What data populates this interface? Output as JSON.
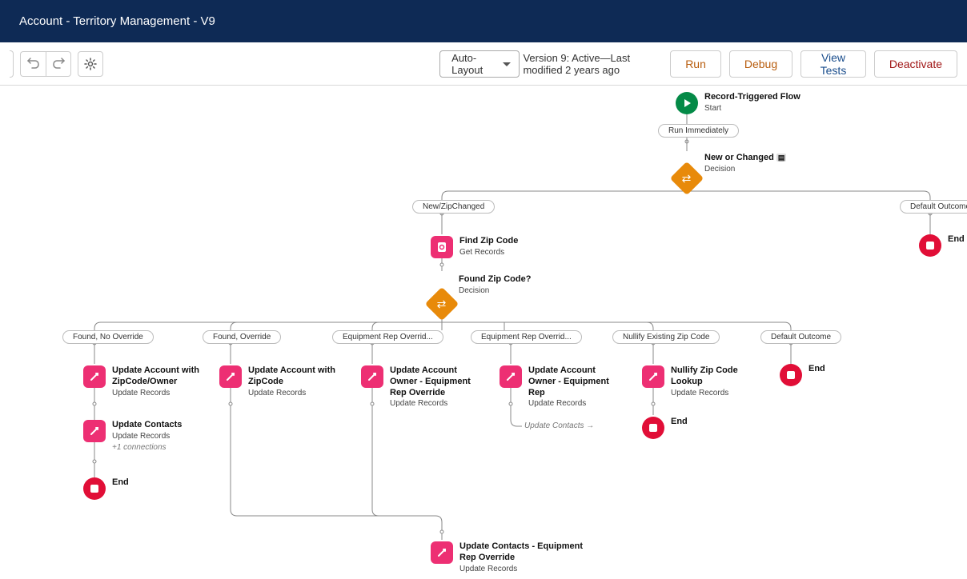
{
  "header": {
    "title": "Account - Territory Management - V9"
  },
  "toolbar": {
    "auto_layout": "Auto-Layout",
    "status": "Version 9: Active—Last modified 2 years ago",
    "run": "Run",
    "debug": "Debug",
    "view_tests": "View Tests",
    "deactivate": "Deactivate"
  },
  "flow": {
    "start": {
      "title": "Record-Triggered Flow",
      "sub": "Start"
    },
    "run_immediately": "Run Immediately",
    "decision1": {
      "title": "New or Changed",
      "sub": "Decision"
    },
    "outcome_new": "New/ZipChanged",
    "outcome_default1": "Default Outcome",
    "end_top": "End",
    "find_zip": {
      "title": "Find Zip Code",
      "sub": "Get Records"
    },
    "decision2": {
      "title": "Found Zip Code?",
      "sub": "Decision"
    },
    "out_found_no_override": "Found, No Override",
    "out_found_override": "Found, Override",
    "out_equip_override1": "Equipment Rep Overrid...",
    "out_equip_override2": "Equipment Rep Overrid...",
    "out_nullify": "Nullify Existing Zip Code",
    "out_default2": "Default Outcome",
    "n1": {
      "title": "Update Account with ZipCode/Owner",
      "sub": "Update Records"
    },
    "n2": {
      "title": "Update Account with ZipCode",
      "sub": "Update Records"
    },
    "n3": {
      "title": "Update Account Owner - Equipment Rep Override",
      "sub": "Update Records"
    },
    "n4": {
      "title": "Update Account Owner - Equipment Rep",
      "sub": "Update Records"
    },
    "n5": {
      "title": "Nullify Zip Code Lookup",
      "sub": "Update Records"
    },
    "n_contacts": {
      "title": "Update Contacts",
      "sub": "Update Records",
      "extra": "+1 connections"
    },
    "ref_contacts": "Update Contacts →",
    "n_contacts2": {
      "title": "Update Contacts - Equipment Rep Override",
      "sub": "Update Records"
    },
    "end_b1": "End",
    "end_b5": "End",
    "end_b6": "End"
  }
}
